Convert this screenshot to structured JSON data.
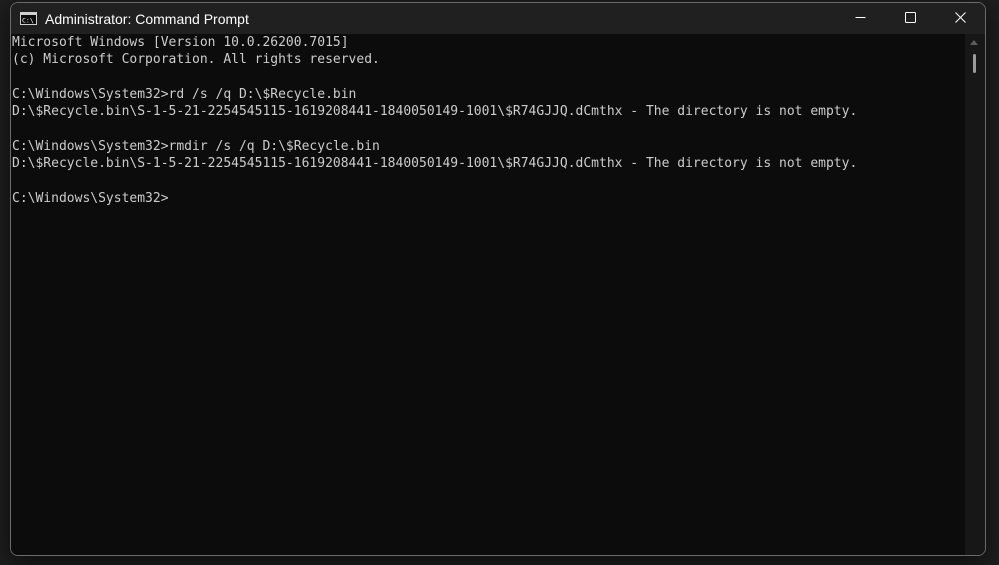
{
  "window": {
    "title": "Administrator: Command Prompt",
    "app_icon": "cmd-icon",
    "buttons": {
      "minimize_icon": "minimize-icon",
      "maximize_icon": "maximize-icon",
      "close_icon": "close-icon"
    }
  },
  "terminal": {
    "lines": [
      "Microsoft Windows [Version 10.0.26200.7015]",
      "(c) Microsoft Corporation. All rights reserved.",
      "",
      "C:\\Windows\\System32>rd /s /q D:\\$Recycle.bin",
      "D:\\$Recycle.bin\\S-1-5-21-2254545115-1619208441-1840050149-1001\\$R74GJJQ.dCmthx - The directory is not empty.",
      "",
      "C:\\Windows\\System32>rmdir /s /q D:\\$Recycle.bin",
      "D:\\$Recycle.bin\\S-1-5-21-2254545115-1619208441-1840050149-1001\\$R74GJJQ.dCmthx - The directory is not empty.",
      "",
      "C:\\Windows\\System32>"
    ]
  },
  "colors": {
    "background": "#0c0c0c",
    "text": "#cccccc",
    "titlebar": "#202020"
  }
}
